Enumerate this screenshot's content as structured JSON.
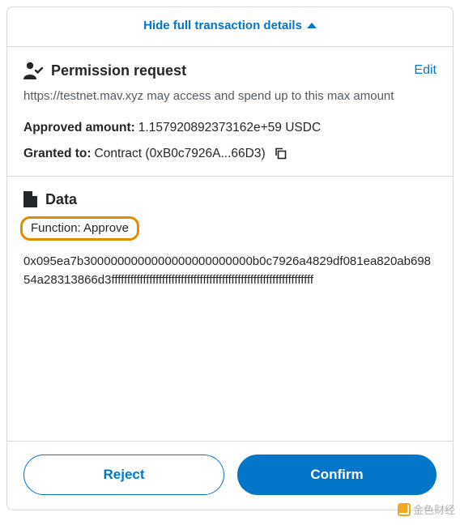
{
  "toggle": {
    "label": "Hide full transaction details"
  },
  "permission": {
    "title": "Permission request",
    "edit": "Edit",
    "description": "https://testnet.mav.xyz may access and spend up to this max amount",
    "approved_label": "Approved amount:",
    "approved_value": "1.157920892373162e+59 USDC",
    "granted_label": "Granted to:",
    "granted_value": "Contract (0xB0c7926A...66D3)"
  },
  "data": {
    "title": "Data",
    "function_label": "Function: Approve",
    "hex": "0x095ea7b3000000000000000000000000b0c7926a4829df081ea820ab69854a28313866d3ffffffffffffffffffffffffffffffffffffffffffffffffffffffffffffffff"
  },
  "footer": {
    "reject": "Reject",
    "confirm": "Confirm"
  },
  "watermark": {
    "text": "金色财经"
  },
  "colors": {
    "accent": "#0376c9",
    "highlight_border": "#e68a00"
  }
}
